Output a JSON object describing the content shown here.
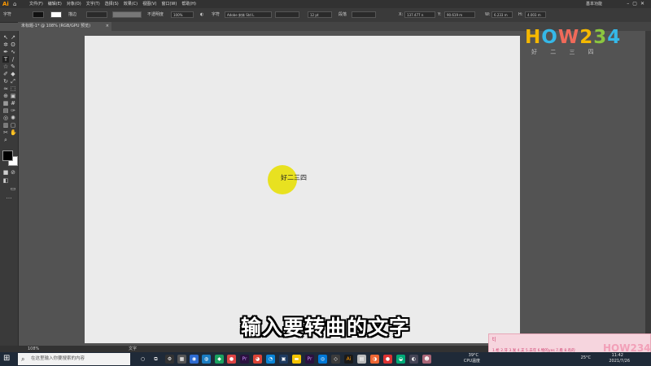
{
  "app": {
    "logo": "Ai",
    "home_icon": "home-icon",
    "workspace": "基本功能"
  },
  "menus": [
    "文件(F)",
    "编辑(E)",
    "对象(O)",
    "文字(T)",
    "选择(S)",
    "效果(C)",
    "视图(V)",
    "窗口(W)",
    "帮助(H)"
  ],
  "control_bar": {
    "mode_label": "字符",
    "stroke_label": "描边",
    "opacity_label": "不透明度",
    "opacity_value": "100%",
    "char_label": "字符",
    "font_name": "Adobe 宋体 Std L",
    "font_size": "12 pt",
    "para_label": "段落",
    "x_value": "137.477 n",
    "y_value": "90.619 m",
    "w_value": "6.233 m",
    "h_value": "4.003 m"
  },
  "document_tab": {
    "title": "未标题-1* @ 108% (RGB/GPU 预览)",
    "close": "×"
  },
  "canvas": {
    "sample_text": "好二三四",
    "highlight_color": "#e8e120"
  },
  "subtitle": "输入要转曲的文字",
  "status_bar": {
    "zoom": "108%",
    "tool": "文字"
  },
  "watermark": {
    "logo": "HOW234",
    "tagline": "好 二 三 四"
  },
  "taskbar": {
    "search_placeholder": "在这里输入你要搜索的内容",
    "weather_temp": "39°C",
    "weather_desc": "CPU温度",
    "time": "25°C",
    "date": "2021/7/26",
    "clock": "11:42"
  },
  "popup": {
    "cursor": "t|",
    "hint": "1.枪 2.牙 3.发 4.支 5.去年 6.物的yes 7.看 8.有的"
  }
}
